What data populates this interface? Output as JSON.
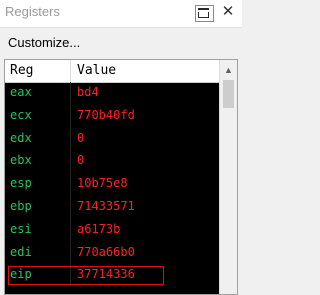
{
  "window": {
    "title": "Registers",
    "close_symbol": "✕"
  },
  "toolbar": {
    "customize_label": "Customize..."
  },
  "table": {
    "headers": {
      "reg": "Reg",
      "value": "Value"
    },
    "rows": [
      {
        "reg": "eax",
        "value": "bd4"
      },
      {
        "reg": "ecx",
        "value": "770b40fd"
      },
      {
        "reg": "edx",
        "value": "0"
      },
      {
        "reg": "ebx",
        "value": "0"
      },
      {
        "reg": "esp",
        "value": "10b75e8"
      },
      {
        "reg": "ebp",
        "value": "71433571"
      },
      {
        "reg": "esi",
        "value": "a6173b"
      },
      {
        "reg": "edi",
        "value": "770a66b0"
      },
      {
        "reg": "eip",
        "value": "37714336",
        "highlighted": true
      }
    ]
  },
  "colors": {
    "background": "#000000",
    "register_name": "#22c55e",
    "value_text": "#ff2020",
    "highlight_border": "#dd1111"
  },
  "icons": {
    "menu": "window-menu-icon",
    "close": "close-icon",
    "scroll_up": "chevron-up-icon"
  }
}
